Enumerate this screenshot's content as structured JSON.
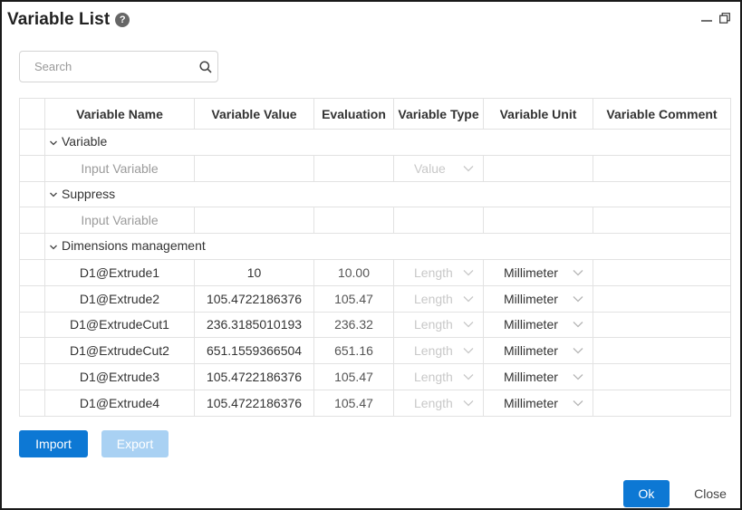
{
  "window": {
    "title": "Variable List",
    "help_glyph": "?",
    "controls": [
      "minimize-icon",
      "restore-icon"
    ]
  },
  "search": {
    "placeholder": "Search",
    "value": ""
  },
  "table": {
    "headers": [
      "Variable Name",
      "Variable Value",
      "Evaluation",
      "Variable Type",
      "Variable Unit",
      "Variable Comment"
    ],
    "groups": [
      {
        "label": "Variable",
        "input_placeholder": "Input Variable",
        "type_placeholder": "Value"
      },
      {
        "label": "Suppress",
        "input_placeholder": "Input Variable"
      },
      {
        "label": "Dimensions management"
      }
    ],
    "rows": [
      {
        "name": "D1@Extrude1",
        "value": "10",
        "evaluation": "10.00",
        "type": "Length",
        "unit": "Millimeter",
        "comment": ""
      },
      {
        "name": "D1@Extrude2",
        "value": "105.4722186376",
        "evaluation": "105.47",
        "type": "Length",
        "unit": "Millimeter",
        "comment": ""
      },
      {
        "name": "D1@ExtrudeCut1",
        "value": "236.3185010193",
        "evaluation": "236.32",
        "type": "Length",
        "unit": "Millimeter",
        "comment": ""
      },
      {
        "name": "D1@ExtrudeCut2",
        "value": "651.1559366504",
        "evaluation": "651.16",
        "type": "Length",
        "unit": "Millimeter",
        "comment": ""
      },
      {
        "name": "D1@Extrude3",
        "value": "105.4722186376",
        "evaluation": "105.47",
        "type": "Length",
        "unit": "Millimeter",
        "comment": ""
      },
      {
        "name": "D1@Extrude4",
        "value": "105.4722186376",
        "evaluation": "105.47",
        "type": "Length",
        "unit": "Millimeter",
        "comment": ""
      }
    ]
  },
  "footer": {
    "import_label": "Import",
    "export_label": "Export",
    "ok_label": "Ok",
    "close_label": "Close"
  },
  "colors": {
    "primary": "#0d78d4",
    "primary_disabled": "#a9d1f3",
    "border": "#e2e2e2",
    "placeholder_text": "#9b9b9b"
  }
}
